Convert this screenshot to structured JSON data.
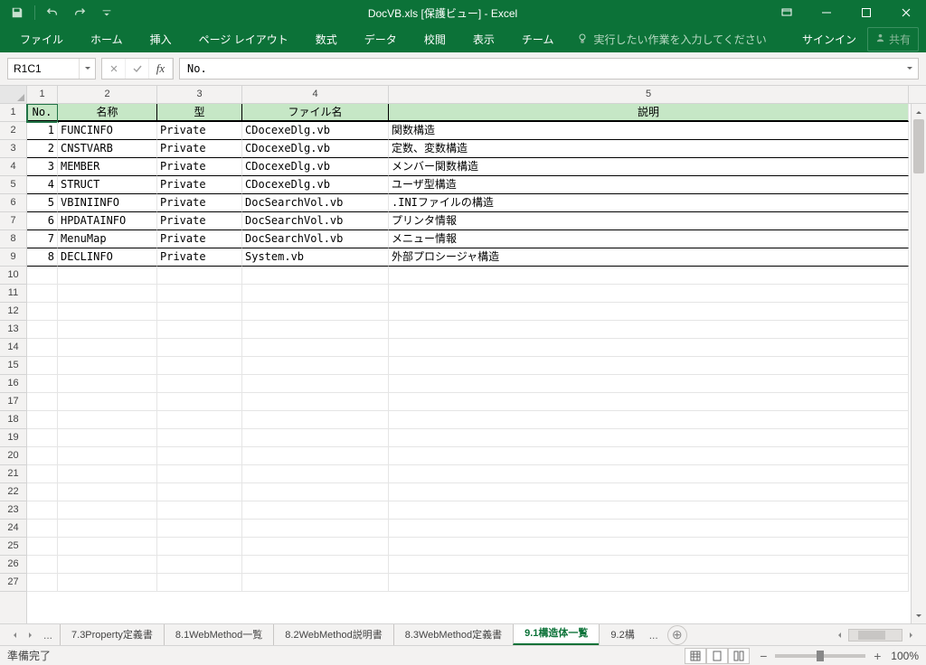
{
  "titlebar": {
    "title": "DocVB.xls [保護ビュー] - Excel"
  },
  "ribbon": {
    "tabs": [
      "ファイル",
      "ホーム",
      "挿入",
      "ページ レイアウト",
      "数式",
      "データ",
      "校閲",
      "表示",
      "チーム"
    ],
    "tell_me": "実行したい作業を入力してください",
    "signin": "サインイン",
    "share": "共有"
  },
  "fxbar": {
    "namebox": "R1C1",
    "formula": "No."
  },
  "grid": {
    "col_labels": [
      "1",
      "2",
      "3",
      "4",
      "5"
    ],
    "row_labels": [
      "1",
      "2",
      "3",
      "4",
      "5",
      "6",
      "7",
      "8",
      "9",
      "10",
      "11",
      "12",
      "13",
      "14",
      "15",
      "16",
      "17",
      "18",
      "19",
      "20",
      "21",
      "22",
      "23",
      "24",
      "25",
      "26",
      "27"
    ],
    "headers": [
      "No.",
      "名称",
      "型",
      "ファイル名",
      "説明"
    ],
    "rows": [
      {
        "no": "1",
        "name": "FUNCINFO",
        "type": "Private",
        "file": "CDocexeDlg.vb",
        "desc": "関数構造"
      },
      {
        "no": "2",
        "name": "CNSTVARB",
        "type": "Private",
        "file": "CDocexeDlg.vb",
        "desc": "定数、変数構造"
      },
      {
        "no": "3",
        "name": "MEMBER",
        "type": "Private",
        "file": "CDocexeDlg.vb",
        "desc": "メンバー関数構造"
      },
      {
        "no": "4",
        "name": "STRUCT",
        "type": "Private",
        "file": "CDocexeDlg.vb",
        "desc": "ユーザ型構造"
      },
      {
        "no": "5",
        "name": "VBINIINFO",
        "type": "Private",
        "file": "DocSearchVol.vb",
        "desc": ".INIファイルの構造"
      },
      {
        "no": "6",
        "name": "HPDATAINFO",
        "type": "Private",
        "file": "DocSearchVol.vb",
        "desc": "プリンタ情報"
      },
      {
        "no": "7",
        "name": "MenuMap",
        "type": "Private",
        "file": "DocSearchVol.vb",
        "desc": "メニュー情報"
      },
      {
        "no": "8",
        "name": "DECLINFO",
        "type": "Private",
        "file": "System.vb",
        "desc": "外部プロシージャ構造"
      }
    ]
  },
  "sheets": {
    "tabs": [
      "7.3Property定義書",
      "8.1WebMethod一覧",
      "8.2WebMethod説明書",
      "8.3WebMethod定義書",
      "9.1構造体一覧",
      "9.2構"
    ],
    "active_index": 4
  },
  "statusbar": {
    "left": "準備完了",
    "zoom": "100%"
  }
}
